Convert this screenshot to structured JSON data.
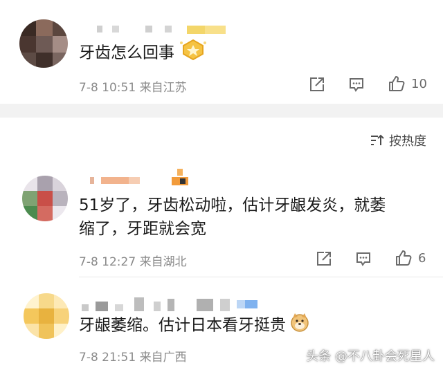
{
  "comments": [
    {
      "text": "牙齿怎么回事",
      "time": "7-8 10:51",
      "location": "来自江苏",
      "likes": "10",
      "has_badge": true
    },
    {
      "text_line1": "51岁了，牙齿松动啦，估计牙龈发炎，就萎",
      "text_line2": "缩了，牙距就会宽",
      "time": "7-8 12:27",
      "location": "来自湖北",
      "likes": "6"
    },
    {
      "text": "牙龈萎缩。估计日本看牙挺贵",
      "time": "7-8 21:51",
      "location": "来自广西"
    }
  ],
  "sort": {
    "label": "按热度",
    "icon": "sort-icon"
  },
  "watermark": "头条 @不八卦会死星人",
  "colors": {
    "accent_gold": "#f5c343",
    "gap_gray": "#f2f2f2",
    "meta_gray": "#8a8a8a"
  }
}
